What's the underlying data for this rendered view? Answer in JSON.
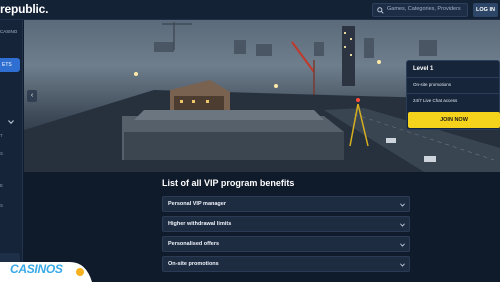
{
  "header": {
    "brand": "republic.",
    "search_placeholder": "Games, Categories, Providers",
    "login_label": "LOG IN"
  },
  "sidebar": {
    "casino_label": "CASINO",
    "active_item_label": "ETS",
    "items": [
      "T",
      "S",
      "E",
      "S"
    ]
  },
  "hero": {
    "level_card": {
      "title": "Level 1",
      "benefits": [
        "On-site promotions",
        "24/7 Live Chat access"
      ],
      "join_label": "JOIN NOW"
    }
  },
  "benefits_section": {
    "title": "List of all VIP program benefits",
    "items": [
      "Personal VIP manager",
      "Higher withdrawal limits",
      "Personalised offers",
      "On-site promotions"
    ]
  },
  "watermark": {
    "text": "CASINOS"
  },
  "colors": {
    "background": "#0f1a2b",
    "accent_blue": "#2f6fd1",
    "join_yellow": "#f5d21c",
    "logo_blue": "#39a9e8"
  }
}
